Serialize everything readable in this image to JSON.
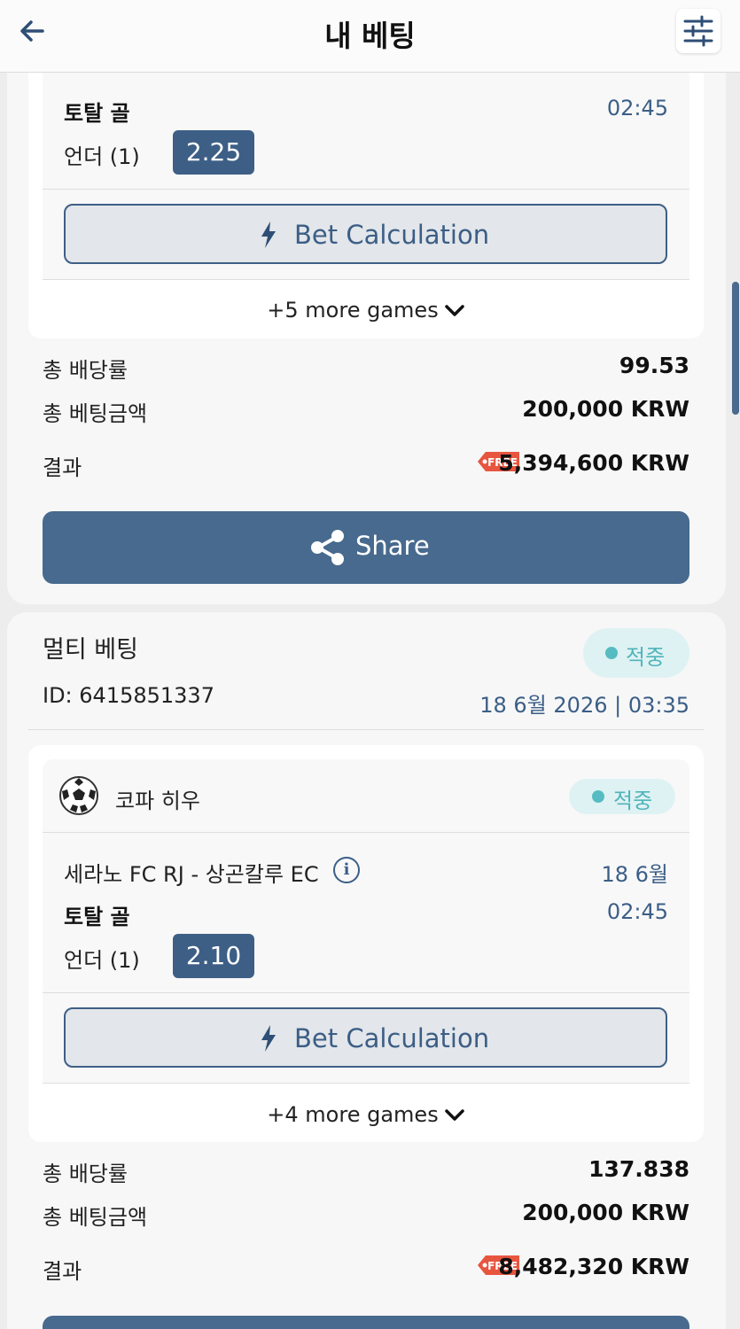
{
  "header": {
    "title": "내 베팅",
    "back_icon": "arrow-left-icon",
    "filter_icon": "sliders-icon"
  },
  "bet1": {
    "game": {
      "market": "토탈 골",
      "time": "02:45",
      "selection": "언더 (1)",
      "odds": "2.25"
    },
    "calc_label": "Bet Calculation",
    "more_games": "+5 more games",
    "summary": {
      "odds_label": "총 배당률",
      "odds_value": "99.53",
      "stake_label": "총 베팅금액",
      "stake_value": "200,000 KRW",
      "result_label": "결과",
      "result_value": "5,394,600 KRW"
    },
    "free_tag": "FREE",
    "share_label": "Share"
  },
  "bet2": {
    "type": "멀티 베팅",
    "status": "적중",
    "id": "ID: 6415851337",
    "datetime": "18 6월 2026 | 03:35",
    "league": "코파 히우",
    "league_status": "적중",
    "game": {
      "teams": "세라노 FC RJ - 상곤칼루 EC",
      "date": "18 6월",
      "market": "토탈 골",
      "time": "02:45",
      "selection": "언더 (1)",
      "odds": "2.10"
    },
    "calc_label": "Bet Calculation",
    "more_games": "+4 more games",
    "summary": {
      "odds_label": "총 배당률",
      "odds_value": "137.838",
      "stake_label": "총 베팅금액",
      "stake_value": "200,000 KRW",
      "result_label": "결과",
      "result_value": "8,482,320 KRW"
    },
    "free_tag": "FREE"
  },
  "colors": {
    "accent": "#3d5f86",
    "won": "#56bcc2",
    "free_tag": "#e8553f"
  }
}
